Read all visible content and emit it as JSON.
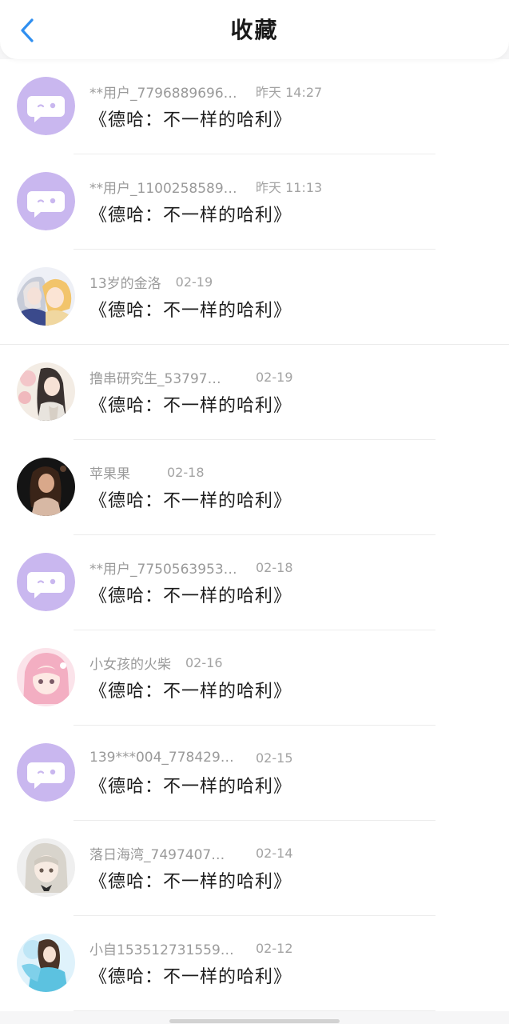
{
  "header": {
    "back_icon": "chevron-left-icon",
    "title": "收藏",
    "accent": "#2f8ff0"
  },
  "items": [
    {
      "user": "**用户_7796889696…",
      "time": "昨天 14:27",
      "content": "《德哈：不一样的哈利》",
      "avatar": "default-chat-avatar"
    },
    {
      "user": "**用户_1100258589…",
      "time": "昨天 11:13",
      "content": "《德哈：不一样的哈利》",
      "avatar": "default-chat-avatar"
    },
    {
      "user": "13岁的金洛",
      "time": "02-19",
      "content": "《德哈：不一样的哈利》",
      "avatar": "anime-couple-avatar"
    },
    {
      "user": "撸串研究生_53797…",
      "time": "02-19",
      "content": "《德哈：不一样的哈利》",
      "avatar": "anime-long-hair-avatar"
    },
    {
      "user": "苹果果",
      "time": "02-18",
      "content": "《德哈：不一样的哈利》",
      "avatar": "photo-woman-avatar"
    },
    {
      "user": "**用户_7750563953…",
      "time": "02-18",
      "content": "《德哈：不一样的哈利》",
      "avatar": "default-chat-avatar"
    },
    {
      "user": "小女孩的火柴",
      "time": "02-16",
      "content": "《德哈：不一样的哈利》",
      "avatar": "anime-pink-hair-avatar"
    },
    {
      "user": "139***004_7784297…",
      "time": "02-15",
      "content": "《德哈：不一样的哈利》",
      "avatar": "default-chat-avatar"
    },
    {
      "user": "落日海湾_7497407…",
      "time": "02-14",
      "content": "《德哈：不一样的哈利》",
      "avatar": "anime-silver-hair-avatar"
    },
    {
      "user": "小自153512731559…",
      "time": "02-12",
      "content": "《德哈：不一样的哈利》",
      "avatar": "anime-blue-dress-avatar"
    }
  ],
  "colors": {
    "default_avatar": "#c9b7ef",
    "background": "#f6f6f7"
  }
}
